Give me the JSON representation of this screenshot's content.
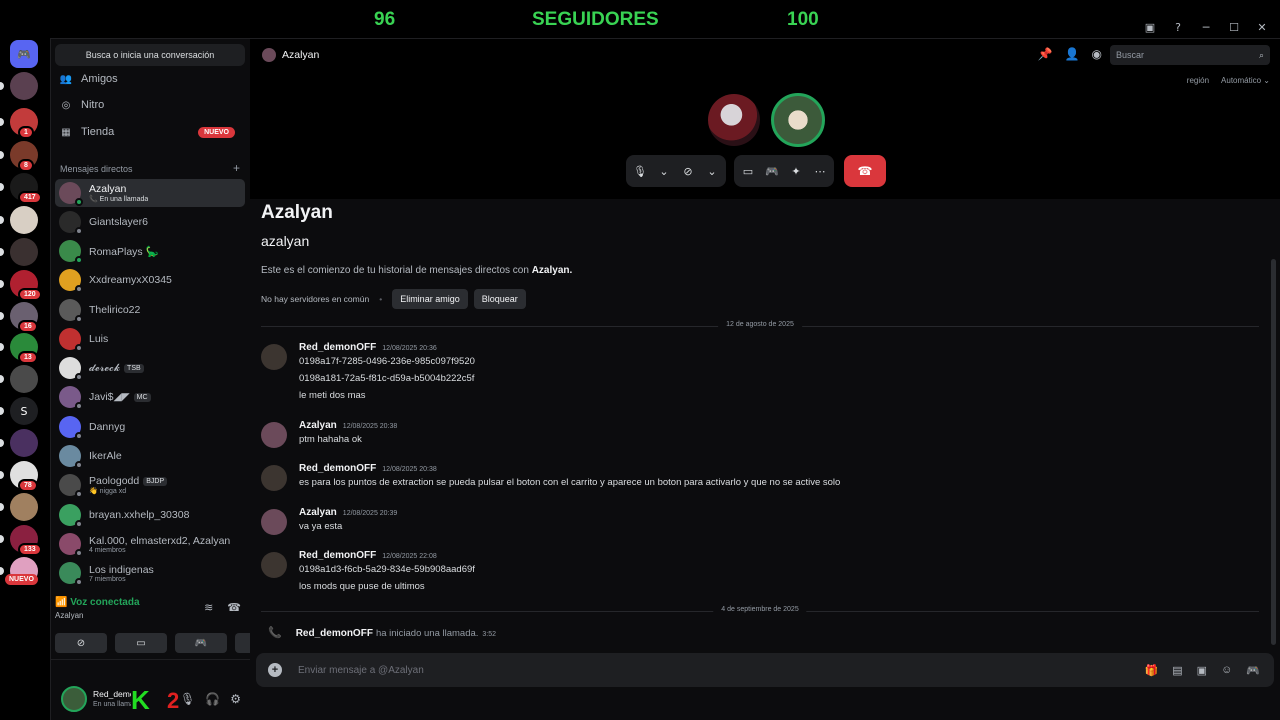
{
  "overlay": {
    "left_number": "96",
    "title": "SEGUIDORES",
    "right_number": "100"
  },
  "servers": [
    {
      "color": "#5865f2",
      "glyph": "🎮"
    },
    {
      "color": "#5a4050",
      "badge": ""
    },
    {
      "color": "#c23b3b",
      "badge": "1"
    },
    {
      "color": "#7a3a2a",
      "badge": "8"
    },
    {
      "color": "#1a1a1a",
      "badge": "417"
    },
    {
      "color": "#d8cfc4",
      "badge": ""
    },
    {
      "color": "#3a3030",
      "badge": ""
    },
    {
      "color": "#b02030",
      "badge": "120"
    },
    {
      "color": "#6a6070",
      "badge": "16"
    },
    {
      "color": "#2a8a3a",
      "badge": "13"
    },
    {
      "color": "#4a4a4a",
      "badge": ""
    },
    {
      "color": "#1e1f22",
      "glyph": "S"
    },
    {
      "color": "#4a3060",
      "badge": ""
    },
    {
      "color": "#e0e0e0",
      "badge": "78"
    },
    {
      "color": "#a08060",
      "badge": ""
    },
    {
      "color": "#8a2040",
      "badge": "133"
    },
    {
      "color": "#e0a0c0",
      "badge": ""
    }
  ],
  "rail_new_badge": "NUEVO",
  "sidebar": {
    "search_label": "Busca o inicia una conversación",
    "nav": [
      {
        "label": "Amigos",
        "icon": "friends-icon",
        "glyph": "👥"
      },
      {
        "label": "Nitro",
        "icon": "nitro-icon",
        "glyph": "◎"
      },
      {
        "label": "Tienda",
        "icon": "shop-icon",
        "glyph": "▦",
        "badge": "NUEVO"
      }
    ],
    "dm_header": "Mensajes directos",
    "dm_add": "+",
    "dms": [
      {
        "name": "Azalyan",
        "sub": "📞 En una llamada",
        "color": "#6b4a5a",
        "online": true,
        "active": true
      },
      {
        "name": "Giantslayer6",
        "sub": "",
        "color": "#2a2a2a",
        "online": false
      },
      {
        "name": "RomaPlays 🦕",
        "sub": "",
        "color": "#3a8a4a",
        "online": true
      },
      {
        "name": "XxdreamyxX0345",
        "sub": "",
        "color": "#e0a020",
        "online": false
      },
      {
        "name": "Thelirico22",
        "sub": "",
        "color": "#5a5a5a",
        "online": false
      },
      {
        "name": "Luis",
        "sub": "",
        "color": "#c03030",
        "online": false
      },
      {
        "name": "𝓭𝓮𝓻𝓮𝓬𝓴",
        "tag": "TSB",
        "sub": "",
        "color": "#dddddd",
        "online": false
      },
      {
        "name": "Javi$◢◤",
        "tag": "MC",
        "sub": "",
        "color": "#7a5a8a",
        "online": false
      },
      {
        "name": "Dannyg",
        "sub": "",
        "color": "#5865f2",
        "online": false
      },
      {
        "name": "IkerAle",
        "sub": "",
        "color": "#6a8aa0",
        "online": false
      },
      {
        "name": "Paologodd",
        "tag": "BJDP",
        "sub": "👋 nigga xd",
        "color": "#4a4a4a",
        "online": false
      },
      {
        "name": "brayan.xxhelp_30308",
        "sub": "",
        "color": "#3aa060",
        "online": false
      },
      {
        "name": "Kal.000, elmasterxd2, Azalyan",
        "sub": "4 miembros",
        "color": "#8a4a6a",
        "online": false
      },
      {
        "name": "Los indigenas",
        "sub": "7 miembros",
        "color": "#3a8a5a",
        "online": false
      }
    ]
  },
  "voice": {
    "title": "Voz conectada",
    "channel": "Azalyan"
  },
  "user": {
    "name": "Red_demonOFF",
    "status": "En una llamada",
    "overlay_k": "K",
    "overlay_2": "2"
  },
  "main": {
    "channel_name": "Azalyan",
    "search_placeholder": "Buscar",
    "region_label": "región",
    "region_value": "Automático ⌄",
    "intro": {
      "display_name": "Azalyan",
      "username": "azalyan",
      "text_prefix": "Este es el comienzo de tu historial de mensajes directos con ",
      "text_name": "Azalyan.",
      "no_servers": "No hay servidores en común",
      "remove_friend": "Eliminar amigo",
      "block": "Bloquear"
    },
    "date1": "12 de agosto de 2025",
    "date2": "4 de septiembre de 2025",
    "messages": [
      {
        "author": "Red_demonOFF",
        "time": "12/08/2025 20:36",
        "lines": [
          "0198a17f-7285-0496-236e-985c097f9520",
          "0198a181-72a5-f81c-d59a-b5004b222c5f",
          "le meti dos mas"
        ],
        "av": "#3c3530"
      },
      {
        "author": "Azalyan",
        "time": "12/08/2025 20:38",
        "lines": [
          "ptm hahaha ok"
        ],
        "av": "#6b4a5a"
      },
      {
        "author": "Red_demonOFF",
        "time": "12/08/2025 20:38",
        "lines": [
          "es para los puntos de extraction se pueda pulsar el boton con el carrito y aparece un boton para activarlo y que no se active solo"
        ],
        "av": "#3c3530"
      },
      {
        "author": "Azalyan",
        "time": "12/08/2025 20:39",
        "lines": [
          "va ya esta"
        ],
        "av": "#6b4a5a"
      },
      {
        "author": "Red_demonOFF",
        "time": "12/08/2025 22:08",
        "lines": [
          "0198a1d3-f6cb-5a29-834e-59b908aad69f",
          "los mods que puse de ultimos"
        ],
        "av": "#3c3530"
      }
    ],
    "call_note": {
      "author": "Red_demonOFF",
      "text": "ha iniciado una llamada.",
      "time": "3:52"
    },
    "composer_placeholder": "Enviar mensaje a @Azalyan"
  }
}
